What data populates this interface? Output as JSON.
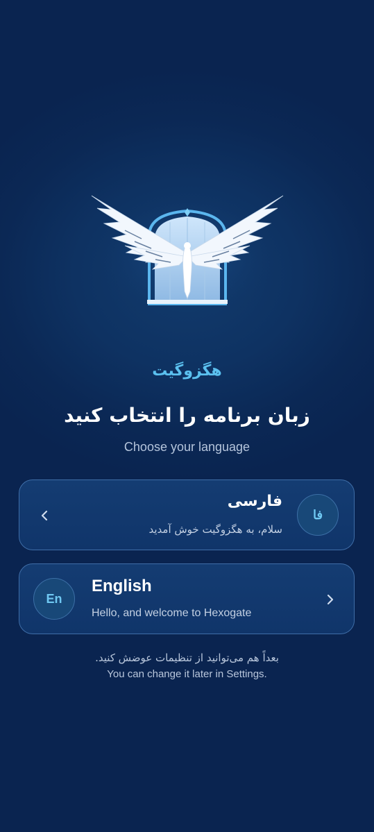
{
  "app": {
    "brand_name": "هگزوگیت"
  },
  "header": {
    "title": "زبان برنامه را انتخاب کنید",
    "subtitle": "Choose your language"
  },
  "languages": [
    {
      "badge": "فا",
      "name": "فارسی",
      "greeting": "سلام، به هگزوگیت خوش آمدید",
      "chevron_icon": "chevron-left-icon"
    },
    {
      "badge": "En",
      "name": "English",
      "greeting": "Hello, and welcome to Hexogate",
      "chevron_icon": "chevron-right-icon"
    }
  ],
  "footer": {
    "note_fa": "بعداً هم می‌توانید از تنظیمات عوضش کنید.",
    "note_en": "You can change it later in Settings."
  },
  "colors": {
    "background": "#0b2855",
    "accent": "#5bc0ef",
    "card_border": "#3f6ea8",
    "card_bg": "#143c72"
  }
}
